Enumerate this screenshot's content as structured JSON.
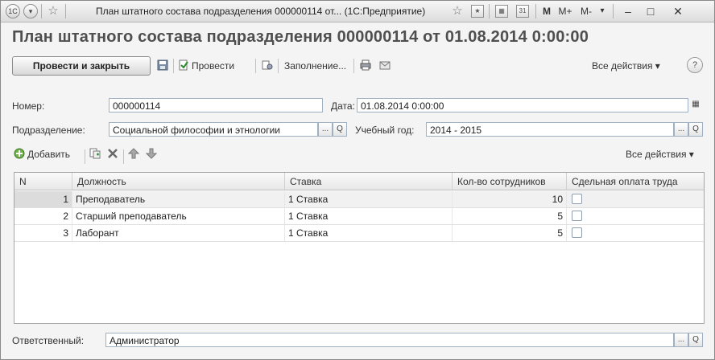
{
  "window": {
    "title": "План штатного состава подразделения 000000114 от...  (1С:Предприятие)",
    "right_buttons": [
      "M",
      "M+",
      "M-"
    ]
  },
  "document": {
    "title": "План штатного состава подразделения 000000114 от 01.08.2014 0:00:00"
  },
  "toolbar": {
    "post_close": "Провести и закрыть",
    "post": "Провести",
    "fill": "Заполнение...",
    "all_actions": "Все действия ▾",
    "help": "?"
  },
  "form": {
    "number_label": "Номер:",
    "number_value": "000000114",
    "date_label": "Дата:",
    "date_value": "01.08.2014  0:00:00",
    "division_label": "Подразделение:",
    "division_value": "Социальной философии и этнологии",
    "year_label": "Учебный год:",
    "year_value": "2014 - 2015",
    "responsible_label": "Ответственный:",
    "responsible_value": "Администратор"
  },
  "table_toolbar": {
    "add": "Добавить",
    "all_actions": "Все действия ▾"
  },
  "table": {
    "columns": [
      "N",
      "Должность",
      "Ставка",
      "Кол-во сотрудников",
      "Сдельная оплата труда"
    ],
    "rows": [
      {
        "n": "1",
        "position": "Преподаватель",
        "rate": "1 Ставка",
        "count": "10",
        "piecework": false
      },
      {
        "n": "2",
        "position": "Старший преподаватель",
        "rate": "1 Ставка",
        "count": "5",
        "piecework": false
      },
      {
        "n": "3",
        "position": "Лаборант",
        "rate": "1 Ставка",
        "count": "5",
        "piecework": false
      }
    ]
  },
  "icons": {
    "ellipsis": "...",
    "search": "Q"
  }
}
